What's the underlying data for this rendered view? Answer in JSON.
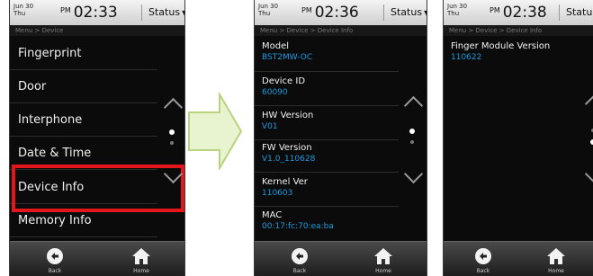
{
  "screens": [
    {
      "date": {
        "day": "Jun 30",
        "weekday": "Thu"
      },
      "time": {
        "ampm": "PM",
        "value": "02:33"
      },
      "status_label": "Status",
      "breadcrumb": "Menu > Device",
      "items": [
        "Fingerprint",
        "Door",
        "Interphone",
        "Date & Time",
        "Device Info",
        "Memory Info"
      ],
      "highlighted": "Device Info",
      "nav": {
        "back": "Back",
        "home": "Home"
      }
    },
    {
      "date": {
        "day": "Jun 30",
        "weekday": "Thu"
      },
      "time": {
        "ampm": "PM",
        "value": "02:36"
      },
      "status_label": "Status",
      "breadcrumb": "Menu > Device > Device Info",
      "fields": [
        {
          "label": "Model",
          "value": "BST2MW-OC"
        },
        {
          "label": "Device ID",
          "value": "60090"
        },
        {
          "label": "HW Version",
          "value": "V01"
        },
        {
          "label": "FW Version",
          "value": "V1.0_110628"
        },
        {
          "label": "Kernel Ver",
          "value": "110603"
        },
        {
          "label": "MAC",
          "value": "00:17:fc:70:ea:ba"
        }
      ],
      "nav": {
        "back": "Back",
        "home": "Home"
      }
    },
    {
      "date": {
        "day": "Jun 30",
        "weekday": "Thu"
      },
      "time": {
        "ampm": "PM",
        "value": "02:38"
      },
      "status_label": "Status",
      "breadcrumb": "Menu > Device > Device Info",
      "fields": [
        {
          "label": "Finger Module Version",
          "value": "110622"
        }
      ],
      "nav": {
        "back": "Back",
        "home": "Home"
      }
    }
  ],
  "icons": {
    "back": "back-arrow-icon",
    "home": "home-icon",
    "up": "chevron-up-icon",
    "down": "chevron-down-icon",
    "status": "triangle-down-icon",
    "transition": "right-arrow-icon"
  },
  "colors": {
    "highlight": "#e4161b",
    "value_text": "#1a9be0",
    "arrow_fill": "#e8f3d0",
    "arrow_stroke": "#b9d37e"
  }
}
